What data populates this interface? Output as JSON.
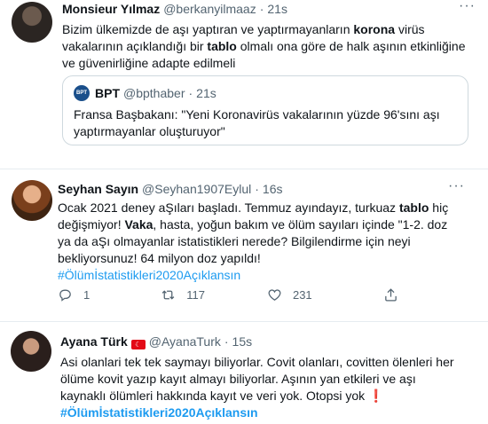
{
  "tweets": [
    {
      "name": "Monsieur Yılmaz",
      "handle": "@berkanyilmaaz",
      "time": "21s",
      "more": "···",
      "segments": [
        {
          "t": "Bizim ülkemizde de aşı yaptıran ve yaptırmayanların "
        },
        {
          "t": "korona",
          "b": true
        },
        {
          "t": " virüs vakalarının açıklandığı bir "
        },
        {
          "t": "tablo",
          "b": true
        },
        {
          "t": " olmalı ona göre de halk aşının etkinliğine ve güvenirliğine adapte edilmeli"
        }
      ],
      "quote": {
        "avatar_text": "BPT",
        "name": "BPT",
        "handle": "@bpthaber",
        "time": "21s",
        "text": "Fransa Başbakanı: \"Yeni Koronavirüs vakalarının yüzde 96'sını aşı yaptırmayanlar oluşturuyor\""
      }
    },
    {
      "name": "Seyhan Sayın",
      "handle": "@Seyhan1907Eylul",
      "time": "16s",
      "more": "···",
      "segments": [
        {
          "t": "Ocak 2021 deney aŞıları başladı. Temmuz ayındayız, turkuaz "
        },
        {
          "t": "tablo",
          "b": true
        },
        {
          "t": " hiç değişmiyor! "
        },
        {
          "t": "Vaka",
          "b": true
        },
        {
          "t": ", hasta, yoğun bakım ve ölüm sayıları içinde \"1-2. doz ya da aŞı olmayanlar istatistikleri nerede? Bilgilendirme için neyi bekliyorsunuz! 64 milyon doz yapıldı!"
        }
      ],
      "hashtag": "#ÖlümİstatistikleriAçıklansın",
      "hashtag_full": "#Ölümİstatistikleri2020Açıklansın",
      "actions": {
        "reply": "1",
        "retweet": "117",
        "like": "231"
      }
    },
    {
      "name": "Ayana Türk",
      "handle": "@AyanaTurk",
      "time": "15s",
      "more": "···",
      "flag": "☾",
      "text": "Asi olanlari tek tek saymayı biliyorlar. Covit olanları, covitten ölenleri her ölüme kovit yazıp kayıt almayı biliyorlar. Aşının yan etkileri ve aşı kaynaklı ölümleri hakkında kayıt ve veri yok. Otopsi yok",
      "exclamation": "❗",
      "hashtag": "#Ölümİstatistikleri2020Açıklansın"
    }
  ],
  "colors": {
    "accent": "#1d9bf0",
    "secondary": "#536471",
    "border": "#cfd9de",
    "flag": "#e30a17"
  },
  "icons": [
    "reply-icon",
    "retweet-icon",
    "like-icon",
    "share-icon",
    "more-icon",
    "flag-icon"
  ]
}
